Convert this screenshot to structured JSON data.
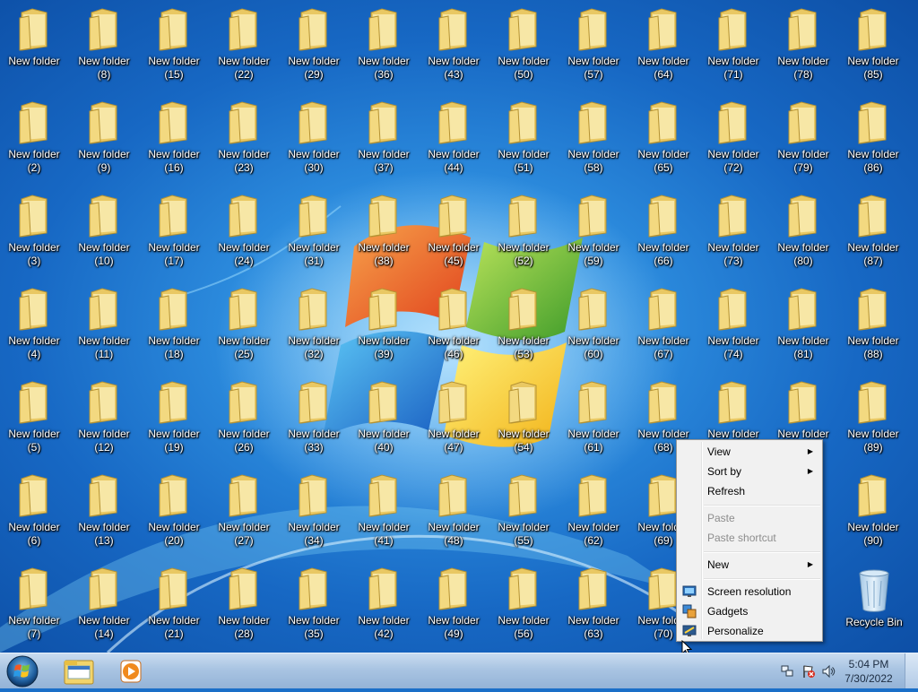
{
  "folders": [
    [
      "New folder",
      ""
    ],
    [
      "New folder",
      "(8)"
    ],
    [
      "New folder",
      "(15)"
    ],
    [
      "New folder",
      "(22)"
    ],
    [
      "New folder",
      "(29)"
    ],
    [
      "New folder",
      "(36)"
    ],
    [
      "New folder",
      "(43)"
    ],
    [
      "New folder",
      "(50)"
    ],
    [
      "New folder",
      "(57)"
    ],
    [
      "New folder",
      "(64)"
    ],
    [
      "New folder",
      "(71)"
    ],
    [
      "New folder",
      "(78)"
    ],
    [
      "New folder",
      "(85)"
    ]
  ],
  "desktop": {
    "columns": [
      [
        "",
        "(2)",
        "(3)",
        "(4)",
        "(5)",
        "(6)",
        "(7)"
      ],
      [
        "(8)",
        "(9)",
        "(10)",
        "(11)",
        "(12)",
        "(13)",
        "(14)"
      ],
      [
        "(15)",
        "(16)",
        "(17)",
        "(18)",
        "(19)",
        "(20)",
        "(21)"
      ],
      [
        "(22)",
        "(23)",
        "(24)",
        "(25)",
        "(26)",
        "(27)",
        "(28)"
      ],
      [
        "(29)",
        "(30)",
        "(31)",
        "(32)",
        "(33)",
        "(34)",
        "(35)"
      ],
      [
        "(36)",
        "(37)",
        "(38)",
        "(39)",
        "(40)",
        "(41)",
        "(42)"
      ],
      [
        "(43)",
        "(44)",
        "(45)",
        "(46)",
        "(47)",
        "(48)",
        "(49)"
      ],
      [
        "(50)",
        "(51)",
        "(52)",
        "(53)",
        "(54)",
        "(55)",
        "(56)"
      ],
      [
        "(57)",
        "(58)",
        "(59)",
        "(60)",
        "(61)",
        "(62)",
        "(63)"
      ],
      [
        "(64)",
        "(65)",
        "(66)",
        "(67)",
        "(68)",
        "(69)",
        "(70)"
      ],
      [
        "(71)",
        "(72)",
        "(73)",
        "(74)",
        "New folder",
        "",
        ""
      ],
      [
        "(78)",
        "(79)",
        "(80)",
        "(81)",
        "New folder",
        "",
        ""
      ],
      [
        "(85)",
        "(86)",
        "(87)",
        "(88)",
        "(89)",
        "(90)",
        null
      ]
    ],
    "folder_label": "New folder",
    "recycle_bin_label": "Recycle Bin"
  },
  "context_menu": {
    "view": "View",
    "sort_by": "Sort by",
    "refresh": "Refresh",
    "paste": "Paste",
    "paste_shortcut": "Paste shortcut",
    "new": "New",
    "screen_resolution": "Screen resolution",
    "gadgets": "Gadgets",
    "personalize": "Personalize"
  },
  "taskbar": {
    "start_icon": "windows-orb-icon",
    "apps": [
      "windows-explorer-icon",
      "media-player-icon"
    ],
    "tray_icons": [
      "network-icon",
      "action-center-flag-icon",
      "volume-icon"
    ],
    "time": "5:04 PM",
    "date": "7/30/2022"
  }
}
